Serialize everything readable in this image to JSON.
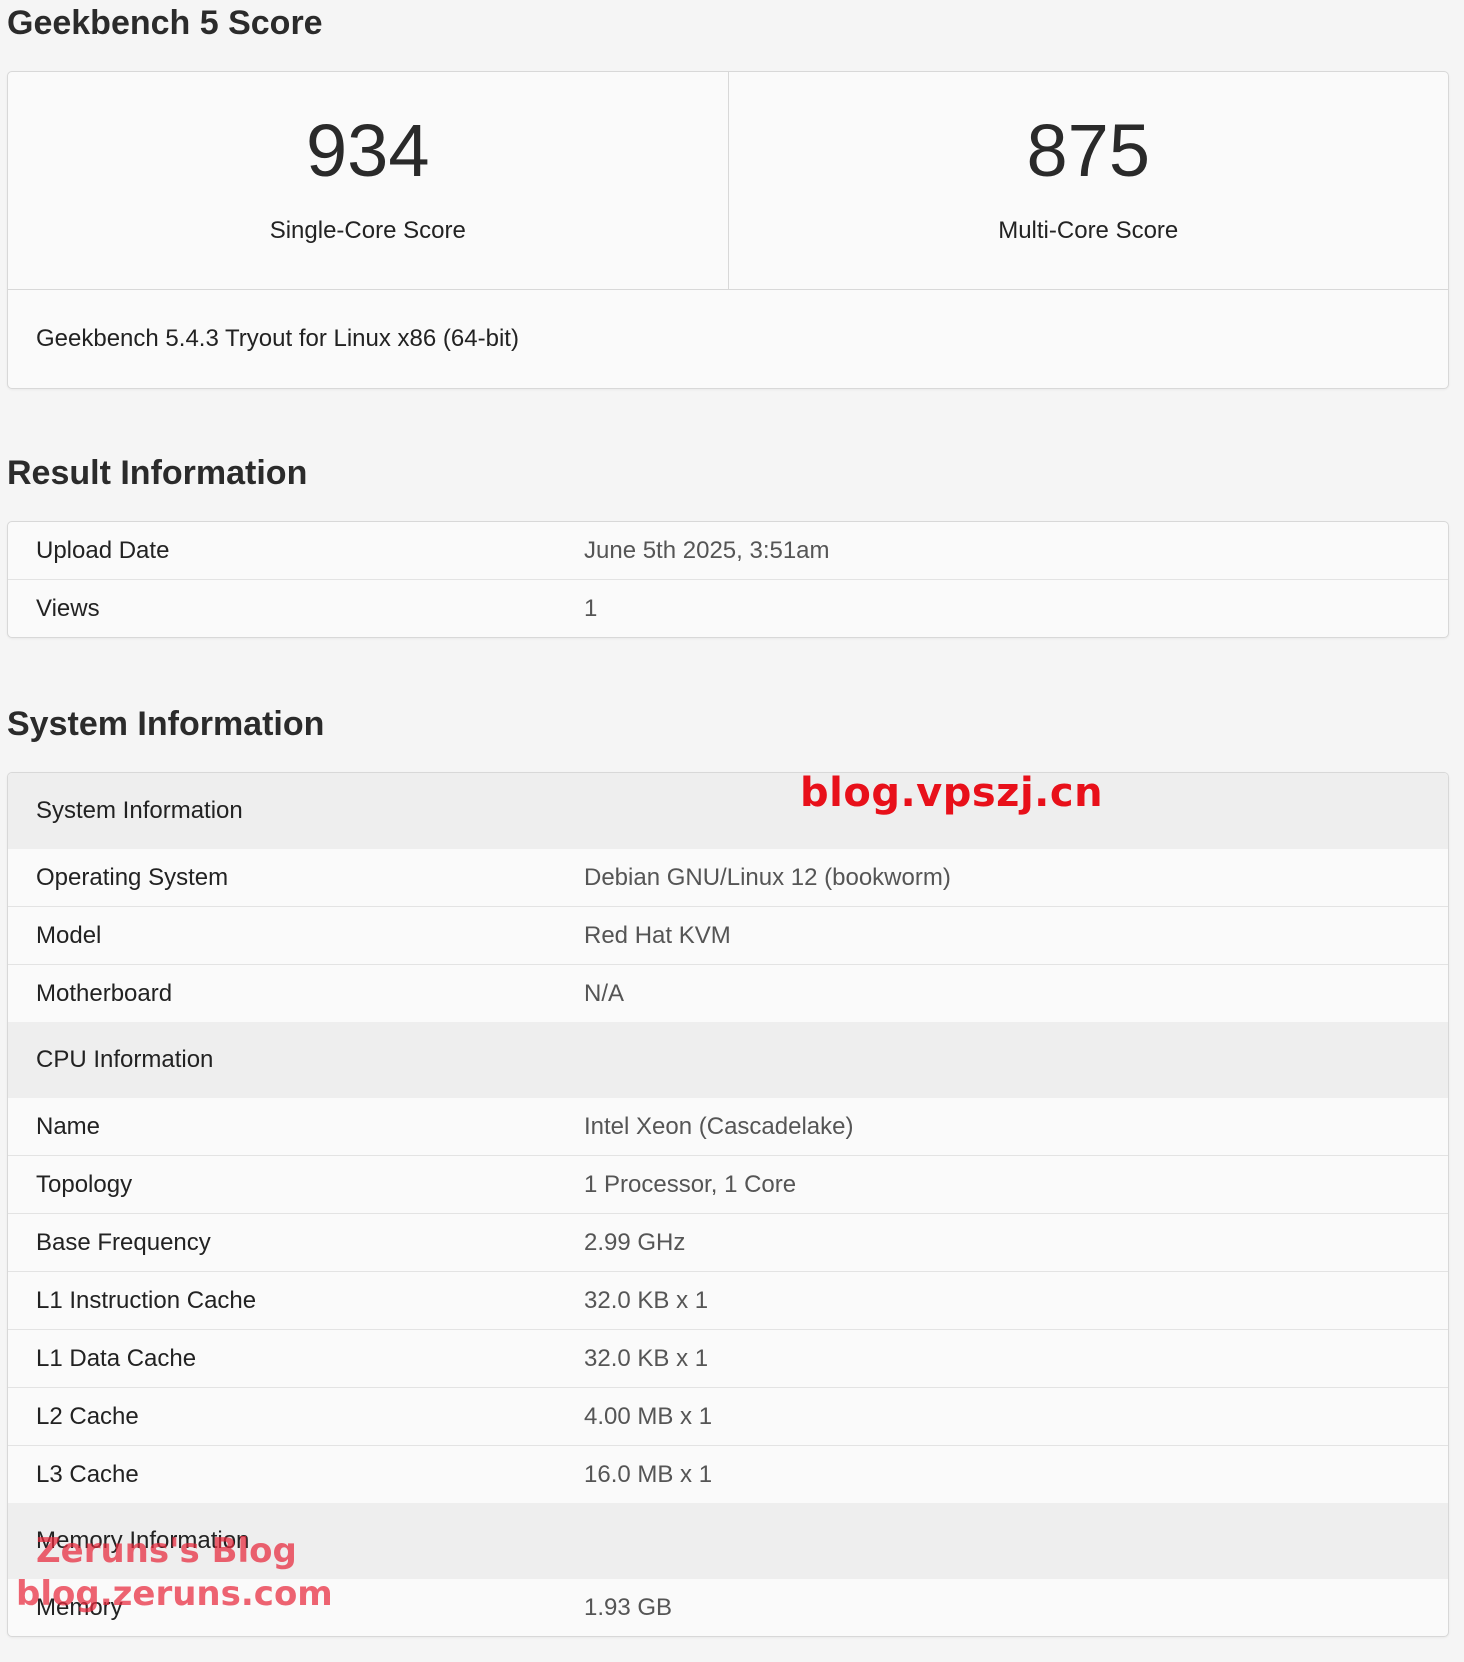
{
  "score_section": {
    "title": "Geekbench 5 Score",
    "single_core": {
      "value": "934",
      "label": "Single-Core Score"
    },
    "multi_core": {
      "value": "875",
      "label": "Multi-Core Score"
    },
    "version": "Geekbench 5.4.3 Tryout for Linux x86 (64-bit)"
  },
  "result_section": {
    "title": "Result Information",
    "rows": [
      {
        "key": "Upload Date",
        "value": "June 5th 2025, 3:51am"
      },
      {
        "key": "Views",
        "value": "1"
      }
    ]
  },
  "system_section": {
    "title": "System Information",
    "groups": [
      {
        "heading": "System Information",
        "rows": [
          {
            "key": "Operating System",
            "value": "Debian GNU/Linux 12 (bookworm)"
          },
          {
            "key": "Model",
            "value": "Red Hat KVM"
          },
          {
            "key": "Motherboard",
            "value": "N/A"
          }
        ]
      },
      {
        "heading": "CPU Information",
        "rows": [
          {
            "key": "Name",
            "value": "Intel Xeon (Cascadelake)"
          },
          {
            "key": "Topology",
            "value": "1 Processor, 1 Core"
          },
          {
            "key": "Base Frequency",
            "value": "2.99 GHz"
          },
          {
            "key": "L1 Instruction Cache",
            "value": "32.0 KB x 1"
          },
          {
            "key": "L1 Data Cache",
            "value": "32.0 KB x 1"
          },
          {
            "key": "L2 Cache",
            "value": "4.00 MB x 1"
          },
          {
            "key": "L3 Cache",
            "value": "16.0 MB x 1"
          }
        ]
      },
      {
        "heading": "Memory Information",
        "rows": [
          {
            "key": "Memory",
            "value": "1.93 GB"
          }
        ]
      }
    ]
  },
  "watermarks": {
    "top": "blog.vpszj.cn",
    "bottom_line1": "Zeruns's Blog",
    "bottom_line2": "blog.zeruns.com"
  },
  "colors": {
    "watermark_red": "#e8101a",
    "group_header_bg": "#eeeeee",
    "card_border": "#d8d8d8"
  }
}
